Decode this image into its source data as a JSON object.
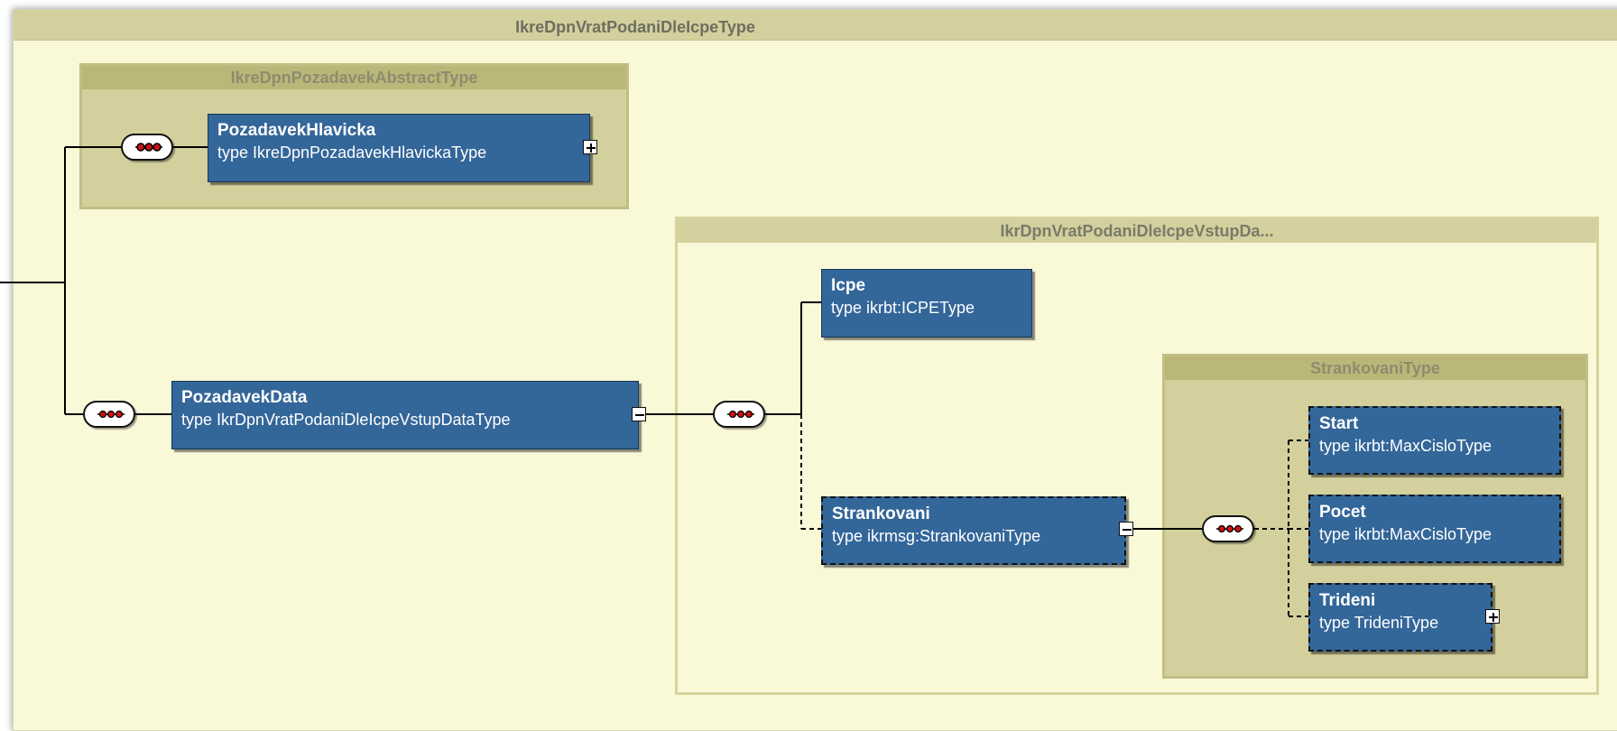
{
  "root_type": {
    "label": "IkreDpnVratPodaniDleIcpeType"
  },
  "abstract_group": {
    "label": "IkreDpnPozadavekAbstractType"
  },
  "data_group": {
    "label": "IkrDpnVratPodaniDleIcpeVstupDa..."
  },
  "paging_group": {
    "label": "StrankovaniType"
  },
  "elements": {
    "pozadavek_hlavicka": {
      "name": "PozadavekHlavicka",
      "type": "type  IkreDpnPozadavekHlavickaType",
      "expander": "plus"
    },
    "pozadavek_data": {
      "name": "PozadavekData",
      "type": "type  IkrDpnVratPodaniDleIcpeVstupDataType",
      "expander": "minus"
    },
    "icpe": {
      "name": "Icpe",
      "type": "type  ikrbt:ICPEType"
    },
    "strankovani": {
      "name": "Strankovani",
      "type": "type  ikrmsg:StrankovaniType",
      "expander": "minus",
      "optional": true
    },
    "start": {
      "name": "Start",
      "type": "type  ikrbt:MaxCisloType",
      "optional": true
    },
    "pocet": {
      "name": "Pocet",
      "type": "type  ikrbt:MaxCisloType",
      "optional": true
    },
    "trideni": {
      "name": "Trideni",
      "type": "type  TrideniType",
      "expander": "plus",
      "optional": true
    }
  },
  "colors": {
    "element_fill": "#336699",
    "group_header": "#d3d09d",
    "canvas": "#f9f8d7",
    "sequence_dot": "#cc1111"
  },
  "icons": [
    "sequence-compositor-icon",
    "expand-plus-icon",
    "collapse-minus-icon"
  ]
}
